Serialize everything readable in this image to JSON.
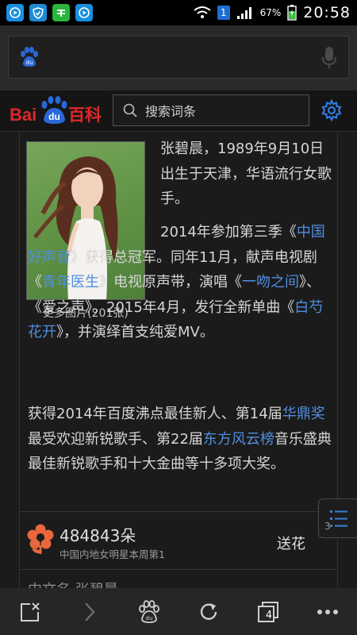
{
  "status_bar": {
    "app_icons": [
      "video-app-icon",
      "shield-app-icon",
      "wechat-app-icon",
      "video-app-icon"
    ],
    "notification_count": "1",
    "battery_percent": "67%",
    "time": "20:58"
  },
  "browser": {
    "address_placeholder": ""
  },
  "baike": {
    "logo_text_latin": "Bai",
    "logo_paw_text": "du",
    "logo_text_cn": "百科",
    "search_placeholder": "搜索词条"
  },
  "article": {
    "photo_caption": "更多图片(201张)",
    "p1": "张碧晨，1989年9月10日出生于天津，华语流行女歌手。",
    "p2_a": "2014年参加第三季《",
    "p2_link1": "中国好声音",
    "p2_b": "》获得总冠军。同年11月，献声电视剧《",
    "p2_link2": "青年医生",
    "p2_c": "》电视原声带，演唱《",
    "p2_link3": "一吻之间",
    "p2_d": "》、《爱之声》。2015年4月，发行全新单曲《",
    "p2_link4": "白芍花开",
    "p2_e": "》，并演绎首支纯爱MV。",
    "p3_a": "获得2014年百度沸点最佳新人、第14届",
    "p3_link1": "华鼎奖",
    "p3_b": "最受欢迎新锐歌手、第22届",
    "p3_link2": "东方风云榜",
    "p3_c": "音乐盛典最佳新锐歌手和十大金曲等十多项大奖。"
  },
  "flower": {
    "count": "484843朵",
    "rank": "中国内地女明星本周第1",
    "send_label": "送花"
  },
  "next_line": "中文名   张碧晨",
  "toc": {
    "badge": "3"
  },
  "toolbar": {
    "tab_count": "4"
  },
  "colors": {
    "link": "#4f8fe0",
    "baidu_red": "#e02828",
    "baidu_blue": "#2a68d8",
    "flower": "#e8673c"
  }
}
